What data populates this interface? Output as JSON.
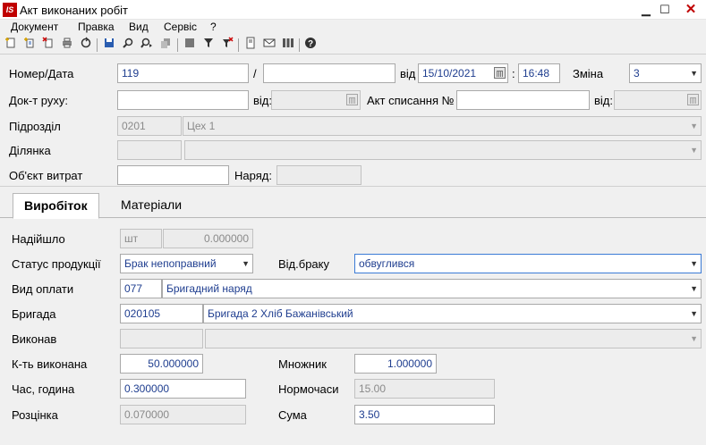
{
  "window": {
    "app_icon_text": "IS",
    "title": "Акт виконаних робіт",
    "minimize": "▁",
    "maximize": "☐",
    "close": "✕"
  },
  "menu": {
    "items": [
      "Документ",
      "Правка",
      "Вид",
      "Сервіс",
      "?"
    ]
  },
  "toolbar": {
    "icons": [
      "new-doc-icon",
      "new-copy-icon",
      "delete-doc-icon",
      "print-icon",
      "refresh-icon",
      "save-icon",
      "search-icon",
      "find-next-icon",
      "copy-icon",
      "stop-icon",
      "filter-icon",
      "clear-filter-icon",
      "document-icon",
      "mail-icon",
      "columns-icon",
      "help-icon"
    ]
  },
  "header": {
    "number_date_label": "Номер/Дата",
    "number_value": "119",
    "slash": "/",
    "number2_value": "",
    "from_label": "від",
    "date_value": "15/10/2021",
    "time_sep": ":",
    "time_value": "16:48",
    "shift_label": "Зміна",
    "shift_value": "3",
    "movement_doc_label": "Док-т руху:",
    "movement_doc_value": "",
    "movement_from_label": "від:",
    "writeoff_label": "Акт списання №",
    "writeoff_value": "",
    "writeoff_from_label": "від:",
    "division_label": "Підрозділ",
    "division_code": "0201",
    "division_name": "Цех 1",
    "area_label": "Ділянка",
    "area_code": "",
    "area_name": "",
    "cost_object_label": "Об'єкт витрат",
    "cost_object_value": "",
    "order_label": "Наряд:",
    "order_value": ""
  },
  "tabs": [
    {
      "label": "Виробіток",
      "active": true
    },
    {
      "label": "Матеріали",
      "active": false
    }
  ],
  "output": {
    "received_label": "Надійшло",
    "received_unit": "шт",
    "received_qty": "0.000000",
    "product_status_label": "Статус продукції",
    "product_status_value": "Брак непоправний",
    "defect_type_label": "Від.браку",
    "defect_type_value": "обвуглився",
    "payment_type_label": "Вид оплати",
    "payment_code": "077",
    "payment_name": "Бригадний наряд",
    "brigade_label": "Бригада",
    "brigade_code": "020105",
    "brigade_name": "Бригада 2 Хліб Бажанівський",
    "performer_label": "Виконав",
    "performer_code": "",
    "performer_name": "",
    "qty_done_label": "К-ть виконана",
    "qty_done_value": "50.000000",
    "multiplier_label": "Множник",
    "multiplier_value": "1.000000",
    "hours_label": "Час, година",
    "hours_value": "0.300000",
    "norm_hours_label": "Нормочаси",
    "norm_hours_value": "15.00",
    "rate_label": "Розцінка",
    "rate_value": "0.070000",
    "sum_label": "Сума",
    "sum_value": "3.50"
  },
  "colors": {
    "value_text": "#1e3d8f",
    "close_button": "#c00000",
    "focus_border": "#3b7bd6"
  }
}
